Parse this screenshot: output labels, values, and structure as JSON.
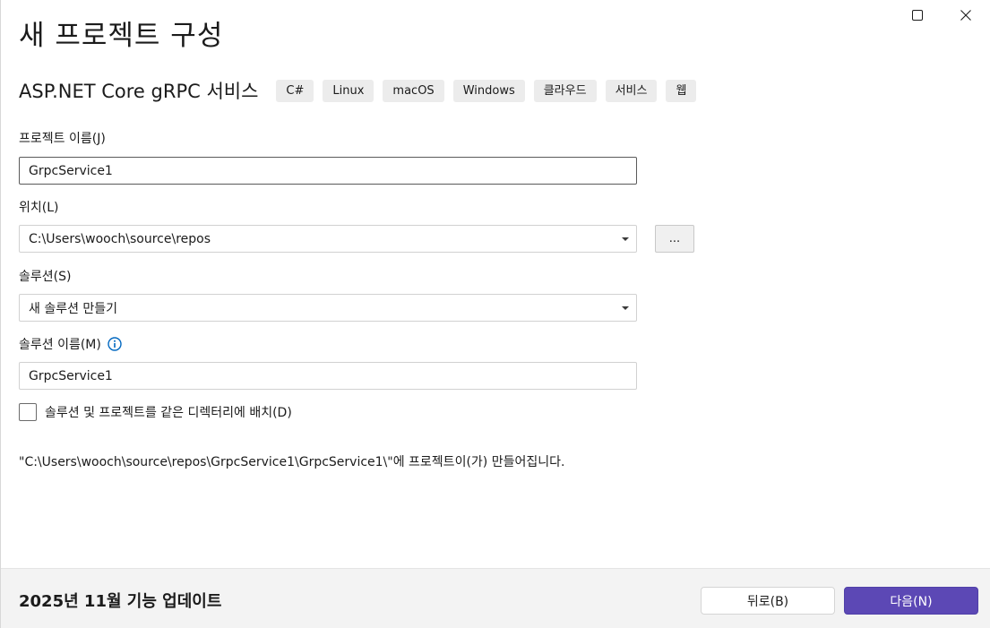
{
  "window": {
    "title": "새 프로젝트 구성"
  },
  "template": {
    "name": "ASP.NET Core gRPC 서비스",
    "tags": [
      "C#",
      "Linux",
      "macOS",
      "Windows",
      "클라우드",
      "서비스",
      "웹"
    ]
  },
  "project_name": {
    "label": "프로젝트 이름(J)",
    "value": "GrpcService1"
  },
  "location": {
    "label": "위치(L)",
    "value": "C:\\Users\\wooch\\source\\repos",
    "browse_label": "..."
  },
  "solution": {
    "label": "솔루션(S)",
    "value": "새 솔루션 만들기"
  },
  "solution_name": {
    "label": "솔루션 이름(M)",
    "value": "GrpcService1"
  },
  "same_directory": {
    "label": "솔루션 및 프로젝트를 같은 디렉터리에 배치(D)",
    "checked": false
  },
  "path_note": "\"C:\\Users\\wooch\\source\\repos\\GrpcService1\\GrpcService1\\\"에 프로젝트이(가) 만들어집니다.",
  "footer": {
    "update_text": "2025년 11월 기능 업데이트",
    "back_label": "뒤로(B)",
    "next_label": "다음(N)"
  },
  "colors": {
    "accent": "#5c48b5",
    "info": "#0067c0"
  }
}
